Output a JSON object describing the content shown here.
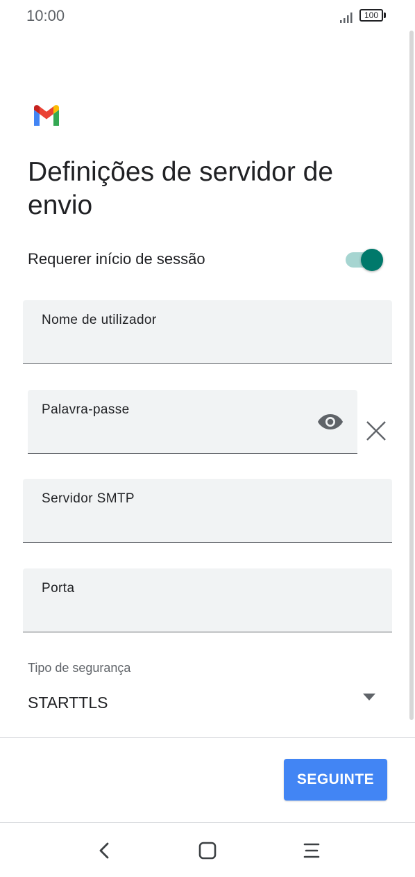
{
  "status_bar": {
    "time": "10:00",
    "battery": "100"
  },
  "page": {
    "title": "Definições de servidor de envio"
  },
  "require_signin": {
    "label": "Requerer início de sessão",
    "enabled": true
  },
  "fields": {
    "username": {
      "label": "Nome de utilizador",
      "value": ""
    },
    "password": {
      "label": "Palavra-passe",
      "value": ""
    },
    "smtp": {
      "label": "Servidor SMTP",
      "value": ""
    },
    "port": {
      "label": "Porta",
      "value": ""
    }
  },
  "security": {
    "label": "Tipo de segurança",
    "value": "STARTTLS"
  },
  "actions": {
    "next_label": "SEGUINTE"
  },
  "colors": {
    "accent": "#00796b",
    "button": "#4285f4",
    "field_bg": "#f1f3f4"
  },
  "icons": {
    "logo": "gmail-logo",
    "password_visibility": "eye-icon",
    "clear": "close-icon",
    "dropdown": "chevron-down-icon",
    "nav": [
      "back-icon",
      "home-icon",
      "menu-icon"
    ]
  }
}
